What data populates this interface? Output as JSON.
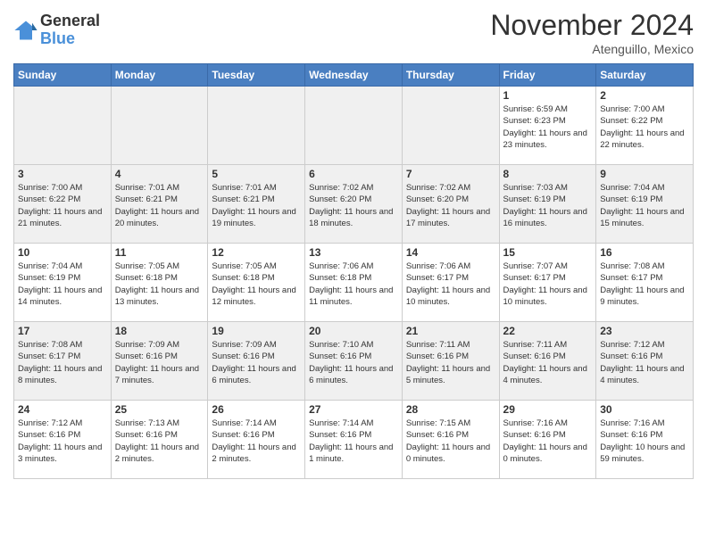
{
  "header": {
    "logo_line1": "General",
    "logo_line2": "Blue",
    "month": "November 2024",
    "location": "Atenguillo, Mexico"
  },
  "weekdays": [
    "Sunday",
    "Monday",
    "Tuesday",
    "Wednesday",
    "Thursday",
    "Friday",
    "Saturday"
  ],
  "weeks": [
    [
      {
        "day": "",
        "info": ""
      },
      {
        "day": "",
        "info": ""
      },
      {
        "day": "",
        "info": ""
      },
      {
        "day": "",
        "info": ""
      },
      {
        "day": "",
        "info": ""
      },
      {
        "day": "1",
        "info": "Sunrise: 6:59 AM\nSunset: 6:23 PM\nDaylight: 11 hours\nand 23 minutes."
      },
      {
        "day": "2",
        "info": "Sunrise: 7:00 AM\nSunset: 6:22 PM\nDaylight: 11 hours\nand 22 minutes."
      }
    ],
    [
      {
        "day": "3",
        "info": "Sunrise: 7:00 AM\nSunset: 6:22 PM\nDaylight: 11 hours\nand 21 minutes."
      },
      {
        "day": "4",
        "info": "Sunrise: 7:01 AM\nSunset: 6:21 PM\nDaylight: 11 hours\nand 20 minutes."
      },
      {
        "day": "5",
        "info": "Sunrise: 7:01 AM\nSunset: 6:21 PM\nDaylight: 11 hours\nand 19 minutes."
      },
      {
        "day": "6",
        "info": "Sunrise: 7:02 AM\nSunset: 6:20 PM\nDaylight: 11 hours\nand 18 minutes."
      },
      {
        "day": "7",
        "info": "Sunrise: 7:02 AM\nSunset: 6:20 PM\nDaylight: 11 hours\nand 17 minutes."
      },
      {
        "day": "8",
        "info": "Sunrise: 7:03 AM\nSunset: 6:19 PM\nDaylight: 11 hours\nand 16 minutes."
      },
      {
        "day": "9",
        "info": "Sunrise: 7:04 AM\nSunset: 6:19 PM\nDaylight: 11 hours\nand 15 minutes."
      }
    ],
    [
      {
        "day": "10",
        "info": "Sunrise: 7:04 AM\nSunset: 6:19 PM\nDaylight: 11 hours\nand 14 minutes."
      },
      {
        "day": "11",
        "info": "Sunrise: 7:05 AM\nSunset: 6:18 PM\nDaylight: 11 hours\nand 13 minutes."
      },
      {
        "day": "12",
        "info": "Sunrise: 7:05 AM\nSunset: 6:18 PM\nDaylight: 11 hours\nand 12 minutes."
      },
      {
        "day": "13",
        "info": "Sunrise: 7:06 AM\nSunset: 6:18 PM\nDaylight: 11 hours\nand 11 minutes."
      },
      {
        "day": "14",
        "info": "Sunrise: 7:06 AM\nSunset: 6:17 PM\nDaylight: 11 hours\nand 10 minutes."
      },
      {
        "day": "15",
        "info": "Sunrise: 7:07 AM\nSunset: 6:17 PM\nDaylight: 11 hours\nand 10 minutes."
      },
      {
        "day": "16",
        "info": "Sunrise: 7:08 AM\nSunset: 6:17 PM\nDaylight: 11 hours\nand 9 minutes."
      }
    ],
    [
      {
        "day": "17",
        "info": "Sunrise: 7:08 AM\nSunset: 6:17 PM\nDaylight: 11 hours\nand 8 minutes."
      },
      {
        "day": "18",
        "info": "Sunrise: 7:09 AM\nSunset: 6:16 PM\nDaylight: 11 hours\nand 7 minutes."
      },
      {
        "day": "19",
        "info": "Sunrise: 7:09 AM\nSunset: 6:16 PM\nDaylight: 11 hours\nand 6 minutes."
      },
      {
        "day": "20",
        "info": "Sunrise: 7:10 AM\nSunset: 6:16 PM\nDaylight: 11 hours\nand 6 minutes."
      },
      {
        "day": "21",
        "info": "Sunrise: 7:11 AM\nSunset: 6:16 PM\nDaylight: 11 hours\nand 5 minutes."
      },
      {
        "day": "22",
        "info": "Sunrise: 7:11 AM\nSunset: 6:16 PM\nDaylight: 11 hours\nand 4 minutes."
      },
      {
        "day": "23",
        "info": "Sunrise: 7:12 AM\nSunset: 6:16 PM\nDaylight: 11 hours\nand 4 minutes."
      }
    ],
    [
      {
        "day": "24",
        "info": "Sunrise: 7:12 AM\nSunset: 6:16 PM\nDaylight: 11 hours\nand 3 minutes."
      },
      {
        "day": "25",
        "info": "Sunrise: 7:13 AM\nSunset: 6:16 PM\nDaylight: 11 hours\nand 2 minutes."
      },
      {
        "day": "26",
        "info": "Sunrise: 7:14 AM\nSunset: 6:16 PM\nDaylight: 11 hours\nand 2 minutes."
      },
      {
        "day": "27",
        "info": "Sunrise: 7:14 AM\nSunset: 6:16 PM\nDaylight: 11 hours\nand 1 minute."
      },
      {
        "day": "28",
        "info": "Sunrise: 7:15 AM\nSunset: 6:16 PM\nDaylight: 11 hours\nand 0 minutes."
      },
      {
        "day": "29",
        "info": "Sunrise: 7:16 AM\nSunset: 6:16 PM\nDaylight: 11 hours\nand 0 minutes."
      },
      {
        "day": "30",
        "info": "Sunrise: 7:16 AM\nSunset: 6:16 PM\nDaylight: 10 hours\nand 59 minutes."
      }
    ]
  ]
}
